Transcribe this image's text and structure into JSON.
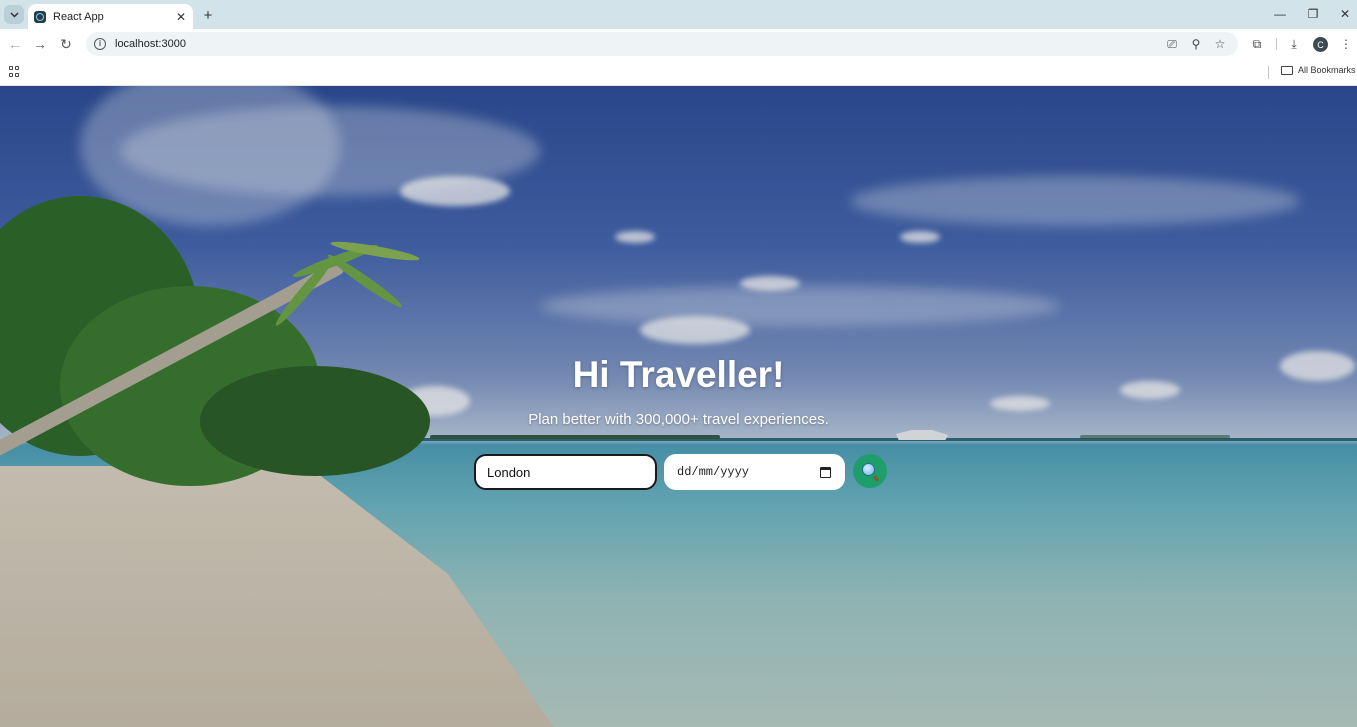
{
  "browser": {
    "tab_title": "React App",
    "url": "localhost:3000",
    "profile_initial": "C",
    "bookmarks_label": "All Bookmarks"
  },
  "hero": {
    "title": "Hi Traveller!",
    "subtitle": "Plan better with 300,000+ travel experiences."
  },
  "search": {
    "city_value": "London",
    "date_placeholder": "dd/mm/yyyy"
  },
  "colors": {
    "search_button": "#1d9e6b",
    "chrome_tabbar": "#d3e3ea"
  }
}
